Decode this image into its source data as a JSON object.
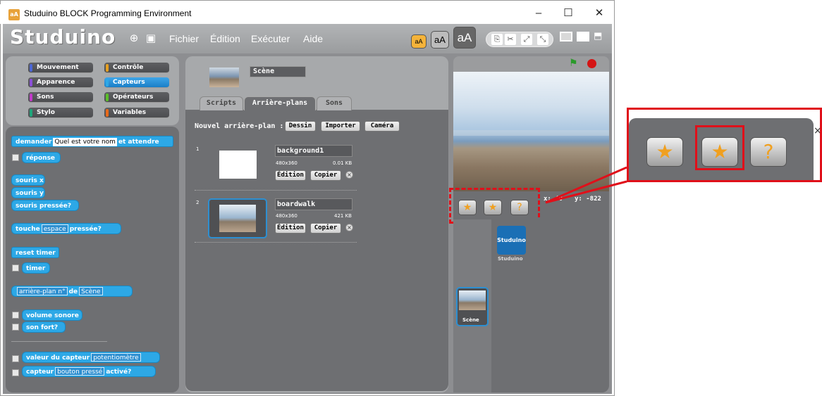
{
  "window": {
    "title": "Studuino BLOCK Programming Environment",
    "controls": [
      "–",
      "☐",
      "✕"
    ]
  },
  "app": {
    "logo": "Studuino",
    "menu": [
      "Fichier",
      "Édition",
      "Exécuter",
      "Aide"
    ],
    "size_buttons": [
      "aA",
      "aA",
      "aA"
    ]
  },
  "categories": [
    {
      "label": "Mouvement",
      "color": "#4b66d6"
    },
    {
      "label": "Contrôle",
      "color": "#e6a021"
    },
    {
      "label": "Apparence",
      "color": "#8a4fd8"
    },
    {
      "label": "Capteurs",
      "color": "#2da8e6"
    },
    {
      "label": "Sons",
      "color": "#c23ac9"
    },
    {
      "label": "Opérateurs",
      "color": "#5cbf2a"
    },
    {
      "label": "Stylo",
      "color": "#1fa57a"
    },
    {
      "label": "Variables",
      "color": "#e86a1a"
    }
  ],
  "blocks": {
    "ask_prefix": "demander",
    "ask_value": "Quel est votre nom",
    "ask_suffix": "et attendre",
    "answer": "réponse",
    "mouse_x": "souris x",
    "mouse_y": "souris y",
    "mouse_down": "souris pressée?",
    "key_prefix": "touche",
    "key_value": "espace",
    "key_suffix": "pressée?",
    "reset_timer": "reset timer",
    "timer": "timer",
    "backdrop_attr": "arrière-plan n°",
    "of": "de",
    "of_target": "Scène",
    "loudness": "volume sonore",
    "loud": "son fort?",
    "sensor_value": "valeur du capteur",
    "sensor_name": "potentiomètre",
    "sensor_prefix": "capteur",
    "sensor_button": "bouton pressé",
    "sensor_suffix": "activé?"
  },
  "center": {
    "scene_name": "Scène",
    "tabs": [
      "Scripts",
      "Arrière-plans",
      "Sons"
    ],
    "new_backdrop": "Nouvel arrière-plan :",
    "new_buttons": [
      "Dessin",
      "Importer",
      "Caméra"
    ],
    "backdrops": [
      {
        "index": "1",
        "name": "background1",
        "size": "480x360",
        "kb": "0.01 KB"
      },
      {
        "index": "2",
        "name": "boardwalk",
        "size": "480x360",
        "kb": "421 KB"
      }
    ],
    "edit": "Édition",
    "copy": "Copier"
  },
  "stage": {
    "x_label": "x:",
    "x_value": "40",
    "y_label": "y:",
    "y_value": "-822"
  },
  "sprites": {
    "studuino_label": "Studuino",
    "studuino_name": "Studuino",
    "scene_label": "Scène"
  },
  "zoom_close": "×"
}
